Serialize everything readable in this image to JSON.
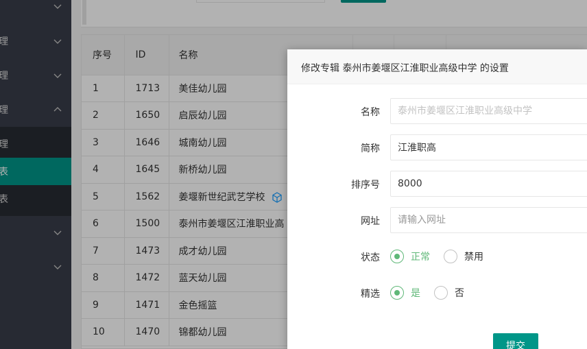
{
  "sidebar": {
    "items": [
      {
        "label": "",
        "top": 0
      },
      {
        "label": "理"
      },
      {
        "label": "理"
      },
      {
        "label": "理"
      },
      {
        "label": ""
      },
      {
        "label": ""
      }
    ],
    "subitems": [
      {
        "label": "理",
        "active": false
      },
      {
        "label": "表",
        "active": true
      },
      {
        "label": "表",
        "active": false
      }
    ]
  },
  "table": {
    "headers": [
      "序号",
      "ID",
      "名称"
    ],
    "rows": [
      {
        "idx": "1",
        "id": "1713",
        "name": "美佳幼儿园"
      },
      {
        "idx": "2",
        "id": "1650",
        "name": "启辰幼儿园"
      },
      {
        "idx": "3",
        "id": "1646",
        "name": "城南幼儿园"
      },
      {
        "idx": "4",
        "id": "1645",
        "name": "新桥幼儿园"
      },
      {
        "idx": "5",
        "id": "1562",
        "name": "姜堰新世纪武艺学校"
      },
      {
        "idx": "6",
        "id": "1500",
        "name": "泰州市姜堰区江淮职业高"
      },
      {
        "idx": "7",
        "id": "1473",
        "name": "成才幼儿园"
      },
      {
        "idx": "8",
        "id": "1472",
        "name": "蓝天幼儿园"
      },
      {
        "idx": "9",
        "id": "1471",
        "name": "金色摇篮"
      },
      {
        "idx": "10",
        "id": "1470",
        "name": "锦都幼儿园"
      }
    ]
  },
  "modal": {
    "title": "修改专辑 泰州市姜堰区江淮职业高级中学 的设置",
    "name_label": "名称",
    "name_placeholder": "泰州市姜堰区江淮职业高级中学",
    "short_label": "简称",
    "short_value": "江淮职高",
    "order_label": "排序号",
    "order_value": "8000",
    "url_label": "网址",
    "url_placeholder": "请输入网址",
    "status_label": "状态",
    "status_options": [
      {
        "label": "正常",
        "checked": true
      },
      {
        "label": "禁用",
        "checked": false
      }
    ],
    "featured_label": "精选",
    "featured_options": [
      {
        "label": "是",
        "checked": true
      },
      {
        "label": "否",
        "checked": false
      }
    ],
    "submit_label": "提交"
  },
  "colors": {
    "sidebar_bg": "#393d49",
    "sidebar_sub_bg": "#282b33",
    "accent": "#009688",
    "radio_checked": "#5fb878"
  },
  "icons": {
    "chevron": "chevron-down-icon",
    "chevron_up": "chevron-up-icon",
    "cube": "cube-icon"
  }
}
